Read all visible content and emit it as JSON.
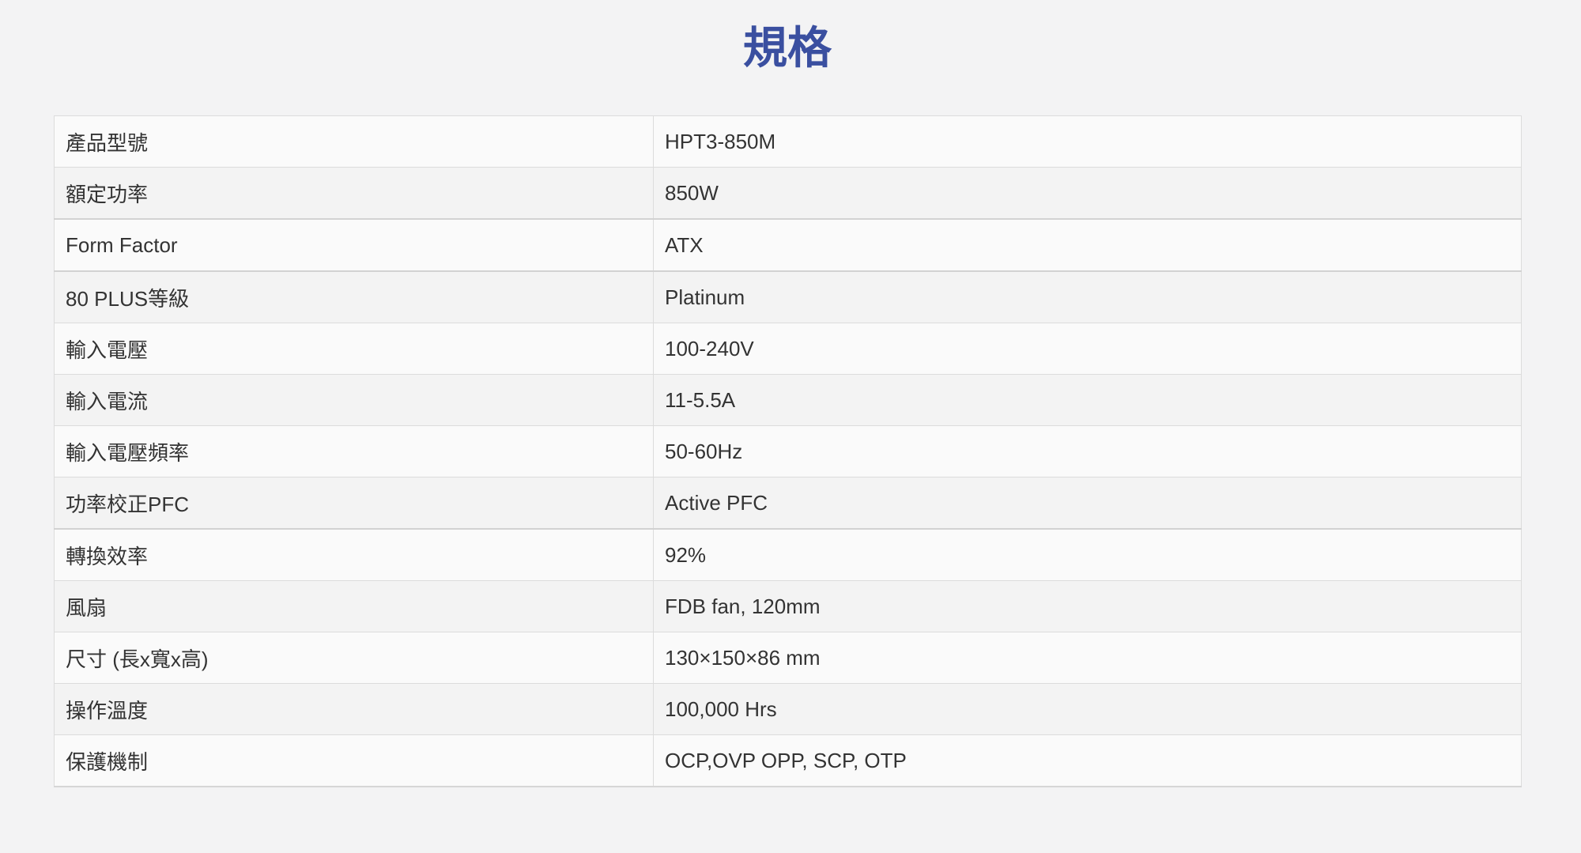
{
  "page": {
    "title": "規格"
  },
  "spec_table": {
    "rows": [
      {
        "label": "產品型號",
        "value": "HPT3-850M"
      },
      {
        "label": "額定功率",
        "value": "850W"
      },
      {
        "label": "Form Factor",
        "value": "ATX"
      },
      {
        "label": "80 PLUS等級",
        "value": "Platinum"
      },
      {
        "label": "輸入電壓",
        "value": "100-240V"
      },
      {
        "label": "輸入電流",
        "value": "11-5.5A"
      },
      {
        "label": "輸入電壓頻率",
        "value": "50-60Hz"
      },
      {
        "label": "功率校正PFC",
        "value": "Active PFC"
      },
      {
        "label": "轉換效率",
        "value": "92%"
      },
      {
        "label": "風扇",
        "value": "FDB fan, 120mm"
      },
      {
        "label": "尺寸 (長x寬x高)",
        "value": "130×150×86 mm"
      },
      {
        "label": "操作溫度",
        "value": "100,000 Hrs"
      },
      {
        "label": "保護機制",
        "value": "OCP,OVP OPP, SCP, OTP"
      }
    ]
  },
  "colors": {
    "title": "#3a4fa0",
    "background": "#f3f3f4",
    "row_light": "#fafafa",
    "row_dark": "#f3f3f3",
    "border": "#dcdcdc",
    "text": "#333333"
  }
}
